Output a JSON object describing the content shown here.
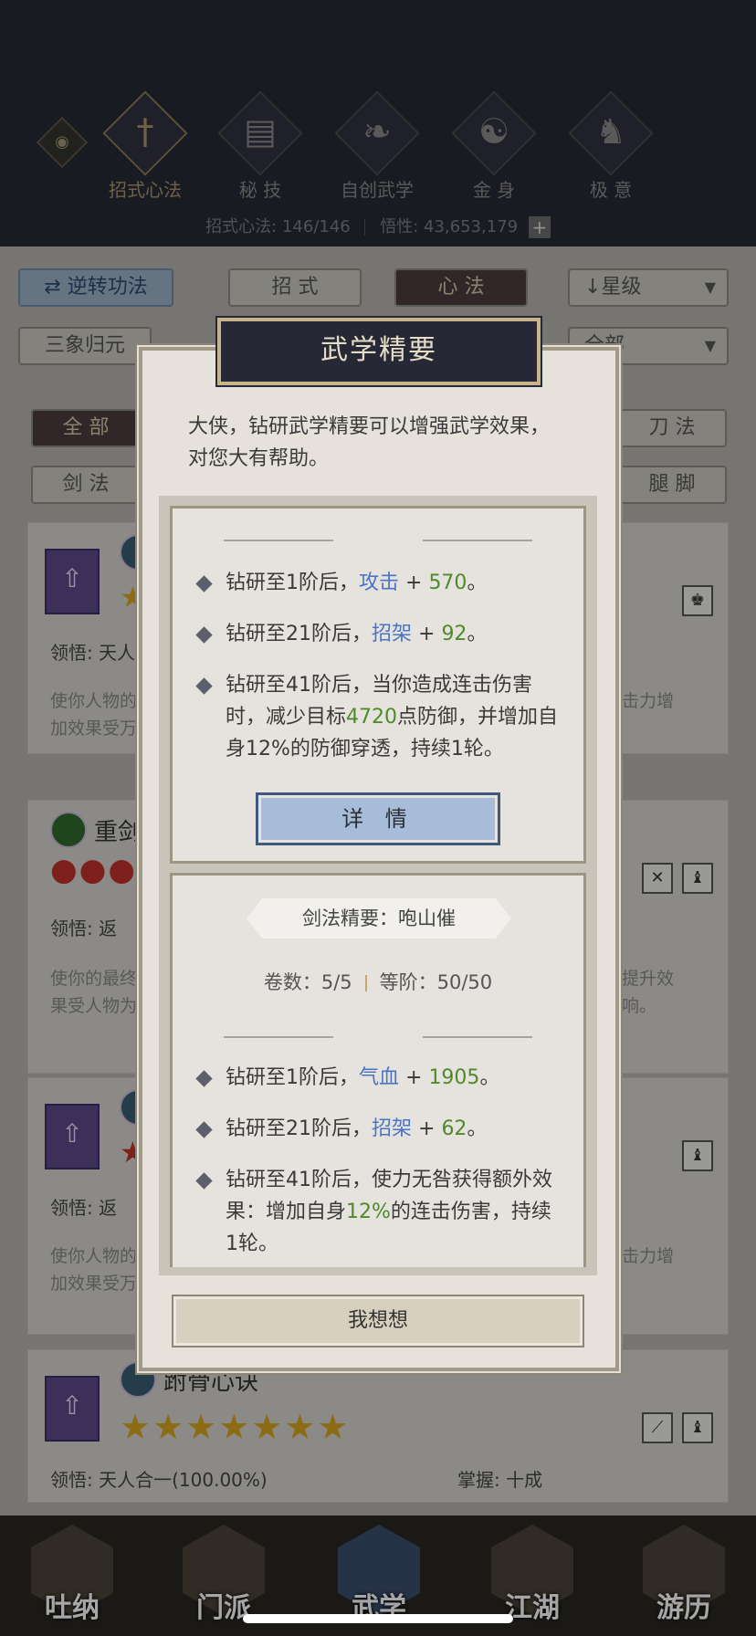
{
  "header": {
    "eye_icon": "eye-icon",
    "categories": [
      {
        "label": "招式心法",
        "icon": "sword-icon",
        "active": true
      },
      {
        "label": "秘 技",
        "icon": "book-icon",
        "active": false
      },
      {
        "label": "自创武学",
        "icon": "scroll-icon",
        "active": false
      },
      {
        "label": "金 身",
        "icon": "meditation-icon",
        "active": false
      },
      {
        "label": "极 意",
        "icon": "martial-pose-icon",
        "active": false
      }
    ],
    "stats": {
      "moves_label": "招式心法:",
      "moves_value": "146/146",
      "insight_label": "悟性:",
      "insight_value": "43,653,179"
    }
  },
  "filters": {
    "reverse_label": "逆转功法",
    "moves_tab": "招 式",
    "heart_tab": "心 法",
    "sort_label": "星级",
    "preset_label": "三象归元",
    "scope_label": "全部",
    "cat_all": "全 部",
    "cat_sword": "剑 法",
    "cat_blade": "刀 法",
    "cat_leg": "腿 脚"
  },
  "cards": [
    {
      "insight_prefix": "领悟:",
      "insight_value": "天人",
      "desc": "使你人物的\n加效果受万",
      "desc_right": "击力增"
    },
    {
      "name": "重剑",
      "insight_prefix": "领悟:",
      "insight_value": "返",
      "desc": "使你的最终\n果受人物为",
      "desc_right": "提升效\n响。"
    },
    {
      "insight_prefix": "领悟:",
      "insight_value": "返",
      "desc": "使你人物的\n加效果受万",
      "desc_right": "击力增"
    },
    {
      "name": "跗骨心诀",
      "insight_prefix": "领悟:",
      "insight_value": "天人合一(100.00%)",
      "mastery_label": "掌握:",
      "mastery_value": "十成",
      "stars": "★★★★★★★"
    }
  ],
  "bottom_nav": [
    {
      "label": "吐纳"
    },
    {
      "label": "门派"
    },
    {
      "label": "武学"
    },
    {
      "label": "江湖"
    },
    {
      "label": "游历"
    }
  ],
  "modal": {
    "title": "武学精要",
    "intro": "大侠，钻研武学精要可以增强武学效果，对您大有帮助。",
    "panel1": {
      "b1_pre": "钻研至1阶后，",
      "b1_attr": "攻击",
      "b1_plus": " + ",
      "b1_val": "570",
      "b1_end": "。",
      "b2_pre": "钻研至21阶后，",
      "b2_attr": "招架",
      "b2_plus": " + ",
      "b2_val": "92",
      "b2_end": "。",
      "b3_pre": "钻研至41阶后，当你造成连击伤害时，减少目标",
      "b3_val": "4720",
      "b3_post": "点防御，并增加自身12%的防御穿透，持续1轮。",
      "detail_button": "详 情"
    },
    "panel2": {
      "tag": "剑法精要：咆山催",
      "volume_label": "卷数：",
      "volume_value": "5/5",
      "rank_label": "等阶：",
      "rank_value": "50/50",
      "b1_pre": "钻研至1阶后，",
      "b1_attr": "气血",
      "b1_plus": " + ",
      "b1_val": "1905",
      "b1_end": "。",
      "b2_pre": "钻研至21阶后，",
      "b2_attr": "招架",
      "b2_plus": " + ",
      "b2_val": "62",
      "b2_end": "。",
      "b3_pre": "钻研至41阶后，使力无咎获得额外效果：增加自身",
      "b3_val": "12%",
      "b3_post": "的连击伤害，持续1轮。"
    },
    "think_button": "我想想"
  }
}
